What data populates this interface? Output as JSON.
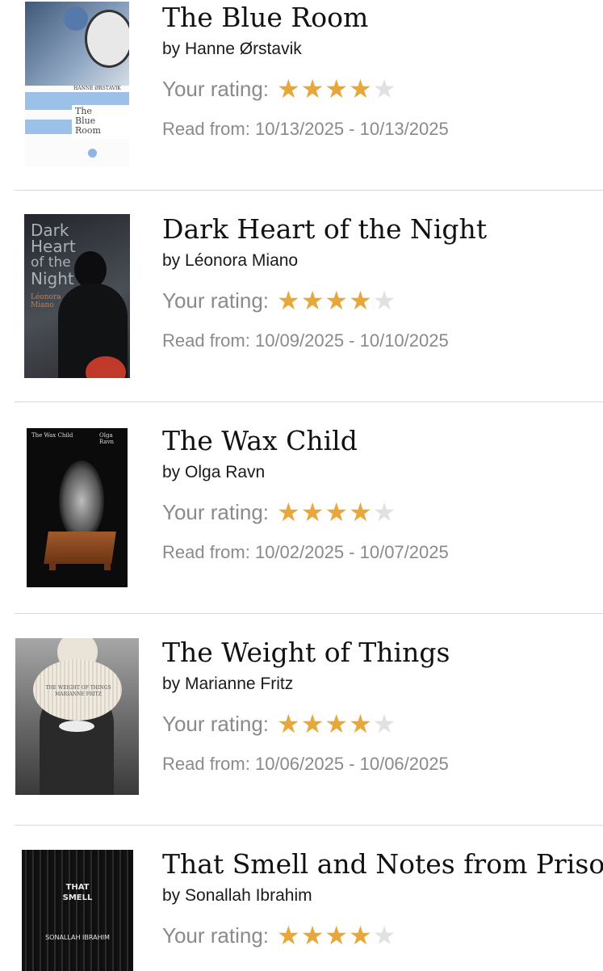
{
  "rating_label": "Your rating:",
  "read_label": "Read from:",
  "star_color": "#e7a73a",
  "books": [
    {
      "title": "The Blue Room",
      "author": "by Hanne Ørstavik",
      "rating": 4,
      "read": "10/13/2025 - 10/13/2025",
      "cover_lines": [
        "The",
        "Blue",
        "Room"
      ],
      "cover_author": "HANNE ØRSTAVIK"
    },
    {
      "title": "Dark Heart of the Night",
      "author": "by Léonora Miano",
      "rating": 4,
      "read": "10/09/2025 - 10/10/2025",
      "cover_lines": [
        "Dark",
        "Heart",
        "of the",
        "Night"
      ],
      "cover_author": "Léonora Miano"
    },
    {
      "title": "The Wax Child",
      "author": "by Olga Ravn",
      "rating": 4,
      "read": "10/02/2025 - 10/07/2025",
      "cover_title": "The Wax Child",
      "cover_author": "Olga Ravn"
    },
    {
      "title": "The Weight of Things",
      "author": "by Marianne Fritz",
      "rating": 4,
      "read": "10/06/2025 - 10/06/2025",
      "cover_title": "THE WEIGHT OF THINGS",
      "cover_author": "MARIANNE FRITZ"
    },
    {
      "title": "That Smell and Notes from Prison",
      "author": "by Sonallah Ibrahim",
      "rating": 4,
      "cover_lines": [
        "THAT",
        "SMELL"
      ],
      "cover_author": "SONALLAH IBRAHIM"
    }
  ]
}
